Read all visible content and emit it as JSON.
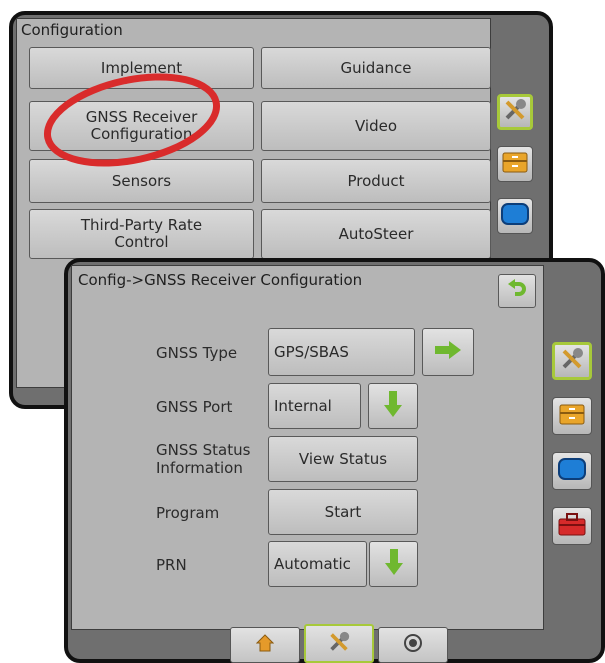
{
  "back_screen": {
    "title": "Configuration",
    "buttons": [
      "Implement",
      "Guidance",
      "GNSS Receiver Configuration",
      "Video",
      "Sensors",
      "Product",
      "Third-Party Rate Control",
      "AutoSteer"
    ],
    "sidebar_icons": [
      "tools-icon",
      "file-cabinet-icon",
      "monitor-icon"
    ]
  },
  "front_screen": {
    "title": "Config->GNSS Receiver Configuration",
    "rows": [
      {
        "label": "GNSS Type",
        "value": "GPS/SBAS",
        "action": "arrow-right-icon"
      },
      {
        "label": "GNSS Port",
        "value": "Internal",
        "action": "arrow-down-icon"
      },
      {
        "label": "GNSS Status Information",
        "value": "View Status"
      },
      {
        "label": "Program",
        "value": "Start"
      },
      {
        "label": "PRN",
        "value": "Automatic",
        "action": "arrow-down-icon"
      }
    ],
    "back_icon": "undo-arrow-icon",
    "sidebar_icons": [
      "tools-icon",
      "file-cabinet-icon",
      "monitor-icon",
      "toolbox-icon"
    ],
    "bottom_tabs": [
      "home-icon",
      "tools-icon",
      "target-icon"
    ]
  },
  "colors": {
    "highlight_ring": "#d92b2b",
    "active_border": "#a7c93a",
    "arrow_green": "#6fb82f",
    "panel": "#b4b4b4",
    "frame": "#6f6f6f"
  }
}
